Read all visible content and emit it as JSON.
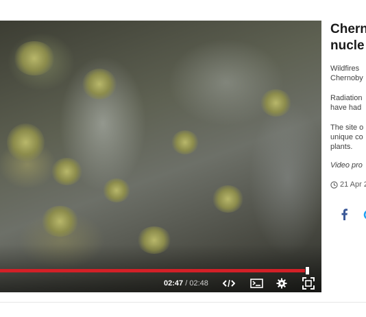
{
  "video": {
    "current_time": "02:47",
    "separator": "/",
    "duration": "02:48",
    "progress": 0.994,
    "accent_color": "#d32027"
  },
  "controls": {
    "embed_icon": "embed-code-icon",
    "subtitles_icon": "subtitles-icon",
    "settings_icon": "gear-icon",
    "fullscreen_icon": "fullscreen-icon"
  },
  "article": {
    "headline_line1": "Cherno",
    "headline_line2": "nucle",
    "para1_line1": "Wildfires",
    "para1_line2": "Chernoby",
    "para2_line1": "Radiation",
    "para2_line2": "have had",
    "para3_line1": "The site o",
    "para3_line2": "unique co",
    "para3_line3": "plants.",
    "credit": "Video pro",
    "date": "21 Apr 2"
  },
  "share": {
    "facebook_icon": "facebook-icon",
    "facebook_color": "#3b5998"
  }
}
